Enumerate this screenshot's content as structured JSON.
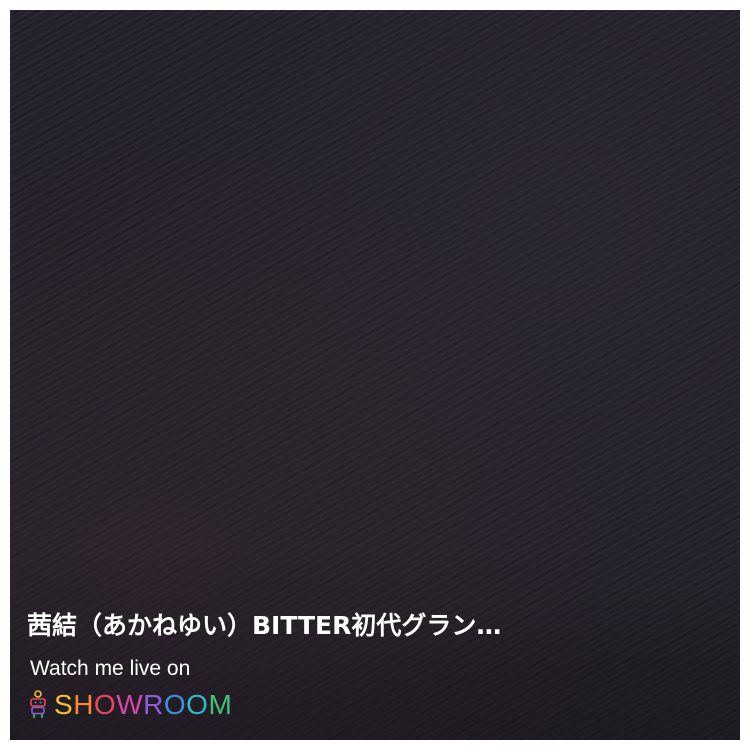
{
  "room": {
    "title": "茜結（あかねゆい）BITTER初代グラン…"
  },
  "promo": {
    "watch_text": "Watch me live on"
  },
  "brand": {
    "letters": [
      "S",
      "H",
      "O",
      "W",
      "R",
      "O",
      "O",
      "M"
    ],
    "colors": [
      "#f4c12a",
      "#f58a2c",
      "#e8455e",
      "#d546a8",
      "#8f5bd6",
      "#3f8de0",
      "#2fb8c9",
      "#3fc27a"
    ],
    "logo_icon": "showroom-mascot-icon"
  },
  "background": {
    "base_color": "#25212a"
  }
}
